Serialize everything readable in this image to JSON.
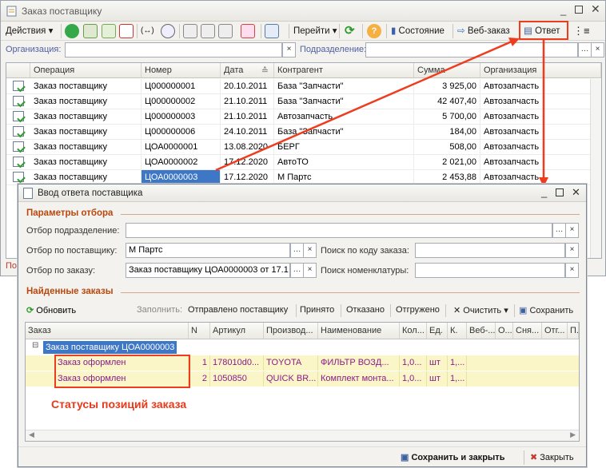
{
  "window1": {
    "title": "Заказ поставщику",
    "toolbar": {
      "actions": "Действия",
      "goto": "Перейти",
      "status": "Состояние",
      "weborder": "Веб-заказ",
      "answer": "Ответ"
    },
    "filter": {
      "org_label": "Организация:",
      "dept_label": "Подразделение:",
      "org_value": "",
      "dept_value": ""
    },
    "columns": [
      "Операция",
      "Номер",
      "Дата",
      "Контрагент",
      "Сумма",
      "Организация"
    ],
    "rows": [
      [
        "Заказ поставщику",
        "Ц000000001",
        "20.10.2011",
        "База \"Запчасти\"",
        "3 925,00",
        "Автозапчасть"
      ],
      [
        "Заказ поставщику",
        "Ц000000002",
        "21.10.2011",
        "База \"Запчасти\"",
        "42 407,40",
        "Автозапчасть"
      ],
      [
        "Заказ поставщику",
        "Ц000000003",
        "21.10.2011",
        "Автозапчасть",
        "5 700,00",
        "Автозапчасть"
      ],
      [
        "Заказ поставщику",
        "Ц000000006",
        "24.10.2011",
        "База \"Запчасти\"",
        "184,00",
        "Автозапчасть"
      ],
      [
        "Заказ поставщику",
        "ЦОА0000001",
        "13.08.2020",
        "БЕРГ",
        "508,00",
        "Автозапчасть"
      ],
      [
        "Заказ поставщику",
        "ЦОА0000002",
        "17.12.2020",
        "АвтоТО",
        "2 021,00",
        "Автозапчасть"
      ],
      [
        "Заказ поставщику",
        "ЦОА0000003",
        "17.12.2020",
        "М Партс",
        "2 453,88",
        "Автозапчасть"
      ]
    ],
    "footer_partial": "По"
  },
  "window2": {
    "title": "Ввод ответа поставщика",
    "params_section": "Параметры отбора",
    "f_dept_label": "Отбор подразделение:",
    "f_supplier_label": "Отбор по поставщику:",
    "f_supplier_value": "М Партс",
    "f_order_label": "Отбор по заказу:",
    "f_order_value": "Заказ поставщику ЦОА0000003 от 17.1",
    "search_code_label": "Поиск по коду заказа:",
    "search_nom_label": "Поиск номенклатуры:",
    "found_section": "Найденные заказы",
    "toolbar": {
      "refresh": "Обновить",
      "fill": "Заполнить:",
      "sent": "Отправлено поставщику",
      "accepted": "Принято",
      "rejected": "Отказано",
      "shipped": "Отгружено",
      "clear": "Очистить",
      "save": "Сохранить"
    },
    "columns": [
      "Заказ",
      "N",
      "Артикул",
      "Производ...",
      "Наименование",
      "Кол...",
      "Ед.",
      "К.",
      "Веб-...",
      "О...",
      "Сня...",
      "Отг...",
      "П..."
    ],
    "group_row": "Заказ поставщику ЦОА0000003",
    "items": [
      {
        "status": "Заказ оформлен",
        "n": "1",
        "article": "178010d0...",
        "maker": "TOYOTA",
        "name": "ФИЛЬТР ВОЗД...",
        "qty": "1,0...",
        "unit": "шт",
        "k": "1,..."
      },
      {
        "status": "Заказ оформлен",
        "n": "2",
        "article": "1050850",
        "maker": "QUICK BR...",
        "name": "Комплект монта...",
        "qty": "1,0...",
        "unit": "шт",
        "k": "1,..."
      }
    ],
    "annotation": "Статусы позиций заказа",
    "save_close": "Сохранить и закрыть",
    "close": "Закрыть"
  },
  "colors": {
    "accent_red": "#ee3d1e",
    "item_text": "#8a1a8a",
    "section": "#b8480f"
  }
}
